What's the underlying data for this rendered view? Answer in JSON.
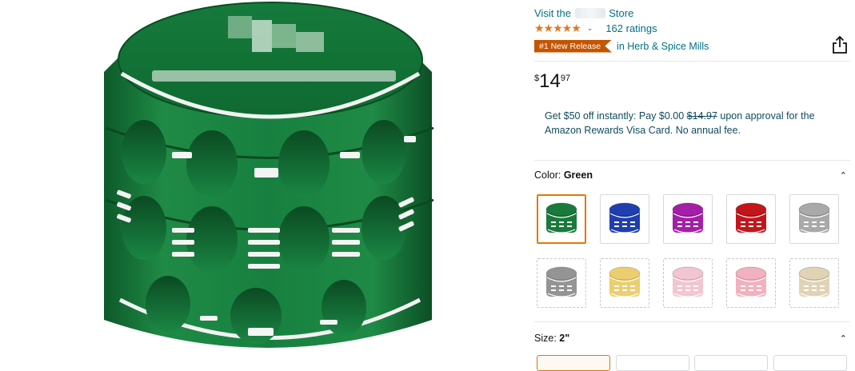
{
  "product": {
    "store_prefix": "Visit the",
    "store_suffix": "Store",
    "stars": "★★★★★",
    "ratings_count": "162 ratings",
    "badge": "#1 New Release",
    "category": "in Herb & Spice Mills",
    "price": {
      "symbol": "$",
      "whole": "14",
      "fraction": "97"
    },
    "promo": {
      "part1": "Get $50 off instantly: Pay $0.00 ",
      "strike": "$14.97",
      "part2": " upon approval for the Amazon Rewards Visa Card. No annual fee."
    }
  },
  "color_option": {
    "label": "Color: ",
    "value": "Green",
    "swatches": [
      {
        "name": "green",
        "color": "#1a7a3c",
        "selected": true,
        "available": true
      },
      {
        "name": "blue",
        "color": "#1f3fae",
        "selected": false,
        "available": true
      },
      {
        "name": "purple",
        "color": "#a51ea8",
        "selected": false,
        "available": true
      },
      {
        "name": "red",
        "color": "#c3161c",
        "selected": false,
        "available": true
      },
      {
        "name": "silver",
        "color": "#a9a9a9",
        "selected": false,
        "available": true
      },
      {
        "name": "gray",
        "color": "#7a7a7a",
        "selected": false,
        "available": false
      },
      {
        "name": "gold",
        "color": "#e9c24a",
        "selected": false,
        "available": false
      },
      {
        "name": "pink",
        "color": "#f0b7c6",
        "selected": false,
        "available": false
      },
      {
        "name": "rose",
        "color": "#ef9eae",
        "selected": false,
        "available": false
      },
      {
        "name": "set",
        "color": "#d9c9a3",
        "selected": false,
        "available": false
      }
    ]
  },
  "size_option": {
    "label": "Size: ",
    "value": "2\""
  },
  "colors": {
    "link": "#007185",
    "badge": "#c45500",
    "selected_border": "#e77600",
    "star": "#de7921",
    "product_green": "#1a7a3c"
  },
  "icons": {
    "share": "share-icon",
    "collapse": "chevron-up-icon",
    "rating_dropdown": "chevron-down-icon"
  }
}
